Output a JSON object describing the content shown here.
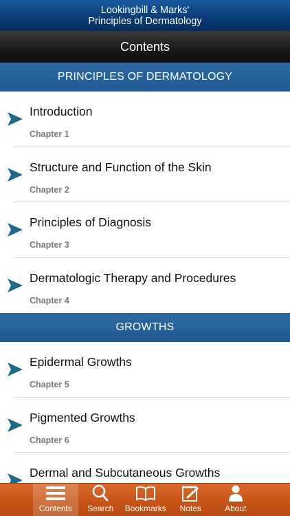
{
  "app": {
    "title_line1": "Lookingbill & Marks'",
    "title_line2": "Principles of Dermatology"
  },
  "nav": {
    "title": "Contents"
  },
  "sections": [
    {
      "title": "PRINCIPLES OF DERMATOLOGY",
      "items": [
        {
          "title": "Introduction",
          "subtitle": "Chapter 1"
        },
        {
          "title": "Structure and Function of the Skin",
          "subtitle": "Chapter 2"
        },
        {
          "title": "Principles of Diagnosis",
          "subtitle": "Chapter 3"
        },
        {
          "title": "Dermatologic Therapy and Procedures",
          "subtitle": "Chapter 4"
        }
      ]
    },
    {
      "title": "GROWTHS",
      "items": [
        {
          "title": "Epidermal Growths",
          "subtitle": "Chapter 5"
        },
        {
          "title": "Pigmented Growths",
          "subtitle": "Chapter 6"
        },
        {
          "title": "Dermal and Subcutaneous Growths",
          "subtitle": ""
        }
      ]
    }
  ],
  "tabs": [
    {
      "label": "Contents",
      "icon": "list-icon",
      "active": true
    },
    {
      "label": "Search",
      "icon": "search-icon",
      "active": false
    },
    {
      "label": "Bookmarks",
      "icon": "book-icon",
      "active": false
    },
    {
      "label": "Notes",
      "icon": "notepad-icon",
      "active": false
    },
    {
      "label": "About",
      "icon": "person-icon",
      "active": false
    }
  ],
  "colors": {
    "header_blue": "#0a3d78",
    "section_blue": "#2562a0",
    "chevron_teal": "#1f6a86",
    "tab_orange": "#c65316"
  }
}
